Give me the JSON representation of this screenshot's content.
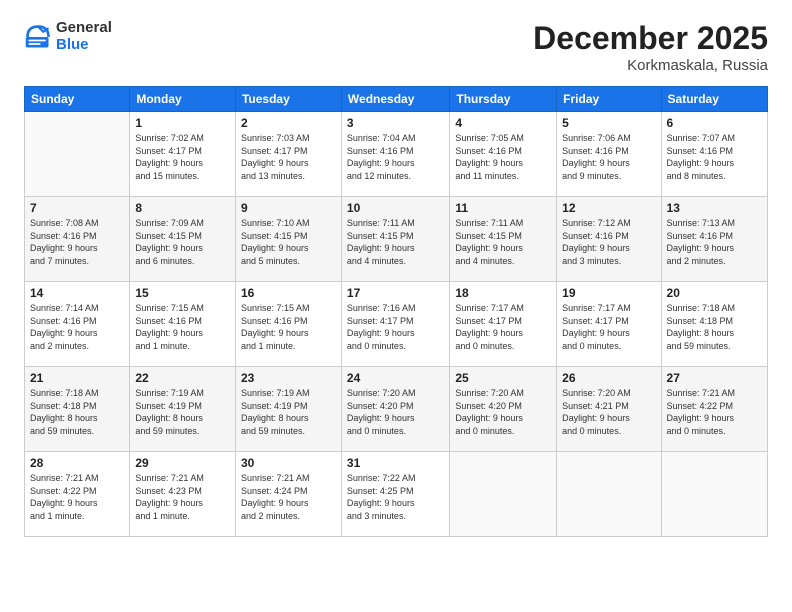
{
  "logo": {
    "general": "General",
    "blue": "Blue"
  },
  "header": {
    "month": "December 2025",
    "location": "Korkmaskala, Russia"
  },
  "weekdays": [
    "Sunday",
    "Monday",
    "Tuesday",
    "Wednesday",
    "Thursday",
    "Friday",
    "Saturday"
  ],
  "days": [
    {
      "date": "",
      "info": ""
    },
    {
      "date": "1",
      "sunrise": "Sunrise: 7:02 AM",
      "sunset": "Sunset: 4:17 PM",
      "daylight": "Daylight: 9 hours and 15 minutes."
    },
    {
      "date": "2",
      "sunrise": "Sunrise: 7:03 AM",
      "sunset": "Sunset: 4:17 PM",
      "daylight": "Daylight: 9 hours and 13 minutes."
    },
    {
      "date": "3",
      "sunrise": "Sunrise: 7:04 AM",
      "sunset": "Sunset: 4:16 PM",
      "daylight": "Daylight: 9 hours and 12 minutes."
    },
    {
      "date": "4",
      "sunrise": "Sunrise: 7:05 AM",
      "sunset": "Sunset: 4:16 PM",
      "daylight": "Daylight: 9 hours and 11 minutes."
    },
    {
      "date": "5",
      "sunrise": "Sunrise: 7:06 AM",
      "sunset": "Sunset: 4:16 PM",
      "daylight": "Daylight: 9 hours and 9 minutes."
    },
    {
      "date": "6",
      "sunrise": "Sunrise: 7:07 AM",
      "sunset": "Sunset: 4:16 PM",
      "daylight": "Daylight: 9 hours and 8 minutes."
    },
    {
      "date": "7",
      "sunrise": "Sunrise: 7:08 AM",
      "sunset": "Sunset: 4:16 PM",
      "daylight": "Daylight: 9 hours and 7 minutes."
    },
    {
      "date": "8",
      "sunrise": "Sunrise: 7:09 AM",
      "sunset": "Sunset: 4:15 PM",
      "daylight": "Daylight: 9 hours and 6 minutes."
    },
    {
      "date": "9",
      "sunrise": "Sunrise: 7:10 AM",
      "sunset": "Sunset: 4:15 PM",
      "daylight": "Daylight: 9 hours and 5 minutes."
    },
    {
      "date": "10",
      "sunrise": "Sunrise: 7:11 AM",
      "sunset": "Sunset: 4:15 PM",
      "daylight": "Daylight: 9 hours and 4 minutes."
    },
    {
      "date": "11",
      "sunrise": "Sunrise: 7:11 AM",
      "sunset": "Sunset: 4:15 PM",
      "daylight": "Daylight: 9 hours and 4 minutes."
    },
    {
      "date": "12",
      "sunrise": "Sunrise: 7:12 AM",
      "sunset": "Sunset: 4:16 PM",
      "daylight": "Daylight: 9 hours and 3 minutes."
    },
    {
      "date": "13",
      "sunrise": "Sunrise: 7:13 AM",
      "sunset": "Sunset: 4:16 PM",
      "daylight": "Daylight: 9 hours and 2 minutes."
    },
    {
      "date": "14",
      "sunrise": "Sunrise: 7:14 AM",
      "sunset": "Sunset: 4:16 PM",
      "daylight": "Daylight: 9 hours and 2 minutes."
    },
    {
      "date": "15",
      "sunrise": "Sunrise: 7:15 AM",
      "sunset": "Sunset: 4:16 PM",
      "daylight": "Daylight: 9 hours and 1 minute."
    },
    {
      "date": "16",
      "sunrise": "Sunrise: 7:15 AM",
      "sunset": "Sunset: 4:16 PM",
      "daylight": "Daylight: 9 hours and 1 minute."
    },
    {
      "date": "17",
      "sunrise": "Sunrise: 7:16 AM",
      "sunset": "Sunset: 4:17 PM",
      "daylight": "Daylight: 9 hours and 0 minutes."
    },
    {
      "date": "18",
      "sunrise": "Sunrise: 7:17 AM",
      "sunset": "Sunset: 4:17 PM",
      "daylight": "Daylight: 9 hours and 0 minutes."
    },
    {
      "date": "19",
      "sunrise": "Sunrise: 7:17 AM",
      "sunset": "Sunset: 4:17 PM",
      "daylight": "Daylight: 9 hours and 0 minutes."
    },
    {
      "date": "20",
      "sunrise": "Sunrise: 7:18 AM",
      "sunset": "Sunset: 4:18 PM",
      "daylight": "Daylight: 8 hours and 59 minutes."
    },
    {
      "date": "21",
      "sunrise": "Sunrise: 7:18 AM",
      "sunset": "Sunset: 4:18 PM",
      "daylight": "Daylight: 8 hours and 59 minutes."
    },
    {
      "date": "22",
      "sunrise": "Sunrise: 7:19 AM",
      "sunset": "Sunset: 4:19 PM",
      "daylight": "Daylight: 8 hours and 59 minutes."
    },
    {
      "date": "23",
      "sunrise": "Sunrise: 7:19 AM",
      "sunset": "Sunset: 4:19 PM",
      "daylight": "Daylight: 8 hours and 59 minutes."
    },
    {
      "date": "24",
      "sunrise": "Sunrise: 7:20 AM",
      "sunset": "Sunset: 4:20 PM",
      "daylight": "Daylight: 9 hours and 0 minutes."
    },
    {
      "date": "25",
      "sunrise": "Sunrise: 7:20 AM",
      "sunset": "Sunset: 4:20 PM",
      "daylight": "Daylight: 9 hours and 0 minutes."
    },
    {
      "date": "26",
      "sunrise": "Sunrise: 7:20 AM",
      "sunset": "Sunset: 4:21 PM",
      "daylight": "Daylight: 9 hours and 0 minutes."
    },
    {
      "date": "27",
      "sunrise": "Sunrise: 7:21 AM",
      "sunset": "Sunset: 4:22 PM",
      "daylight": "Daylight: 9 hours and 0 minutes."
    },
    {
      "date": "28",
      "sunrise": "Sunrise: 7:21 AM",
      "sunset": "Sunset: 4:22 PM",
      "daylight": "Daylight: 9 hours and 1 minute."
    },
    {
      "date": "29",
      "sunrise": "Sunrise: 7:21 AM",
      "sunset": "Sunset: 4:23 PM",
      "daylight": "Daylight: 9 hours and 1 minute."
    },
    {
      "date": "30",
      "sunrise": "Sunrise: 7:21 AM",
      "sunset": "Sunset: 4:24 PM",
      "daylight": "Daylight: 9 hours and 2 minutes."
    },
    {
      "date": "31",
      "sunrise": "Sunrise: 7:22 AM",
      "sunset": "Sunset: 4:25 PM",
      "daylight": "Daylight: 9 hours and 3 minutes."
    }
  ]
}
